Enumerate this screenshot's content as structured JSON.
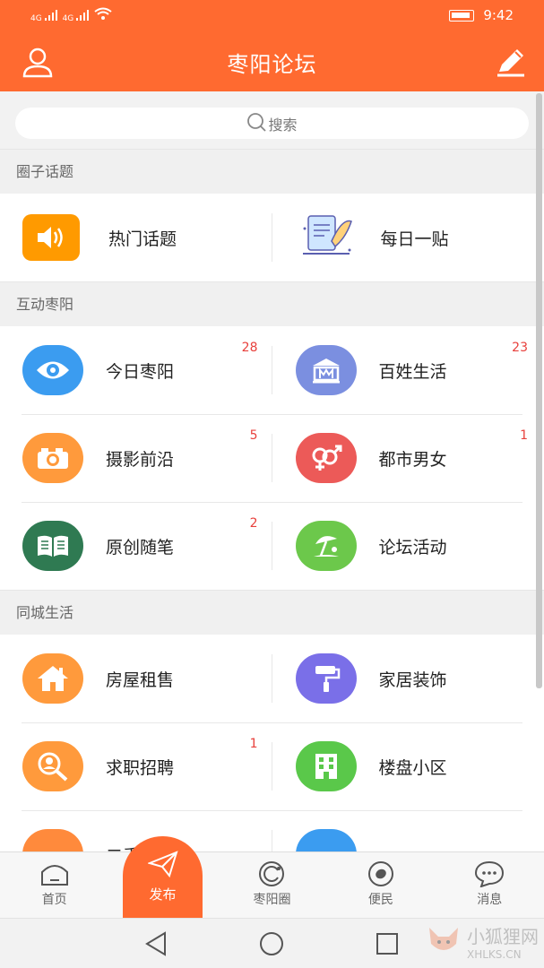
{
  "status_bar": {
    "signal_1": "4G",
    "signal_2": "4G",
    "time": "9:42"
  },
  "app_bar": {
    "title": "枣阳论坛",
    "left_icon": "user-icon",
    "right_icon": "edit-icon"
  },
  "search": {
    "placeholder": "搜索"
  },
  "sections": [
    {
      "title": "圈子话题",
      "rows": [
        [
          {
            "label": "热门话题",
            "icon": "speaker-icon",
            "color": "#ff9a00",
            "badge": ""
          },
          {
            "label": "每日一贴",
            "icon": "daily-post-icon",
            "color": "#ffffff",
            "badge": ""
          }
        ]
      ]
    },
    {
      "title": "互动枣阳",
      "rows": [
        [
          {
            "label": "今日枣阳",
            "icon": "eye-icon",
            "color": "#3b9cf0",
            "badge": "28"
          },
          {
            "label": "百姓生活",
            "icon": "building-icon",
            "color": "#7b8fe0",
            "badge": "23"
          }
        ],
        [
          {
            "label": "摄影前沿",
            "icon": "camera-icon",
            "color": "#ff9a3c",
            "badge": "5"
          },
          {
            "label": "都市男女",
            "icon": "gender-icon",
            "color": "#ec5a58",
            "badge": "1"
          }
        ],
        [
          {
            "label": "原创随笔",
            "icon": "book-icon",
            "color": "#2f7a52",
            "badge": "2"
          },
          {
            "label": "论坛活动",
            "icon": "beach-umbrella-icon",
            "color": "#6cc84b",
            "badge": ""
          }
        ]
      ]
    },
    {
      "title": "同城生活",
      "rows": [
        [
          {
            "label": "房屋租售",
            "icon": "house-icon",
            "color": "#ff9a3c",
            "badge": ""
          },
          {
            "label": "家居装饰",
            "icon": "paint-roller-icon",
            "color": "#7a6fe8",
            "badge": ""
          }
        ],
        [
          {
            "label": "求职招聘",
            "icon": "job-search-icon",
            "color": "#ff9a3c",
            "badge": "1"
          },
          {
            "label": "楼盘小区",
            "icon": "apartment-icon",
            "color": "#5ac84a",
            "badge": ""
          }
        ],
        [
          {
            "label": "二手...",
            "icon": "partial-icon",
            "color": "#ff8a3c",
            "badge": ""
          },
          {
            "label": "... ...",
            "icon": "partial-icon",
            "color": "#3b9cf0",
            "badge": ""
          }
        ]
      ]
    }
  ],
  "tabs": [
    {
      "label": "首页",
      "icon": "home-icon"
    },
    {
      "label": "发布",
      "icon": "send-icon"
    },
    {
      "label": "枣阳圈",
      "icon": "circle-icon"
    },
    {
      "label": "便民",
      "icon": "convenience-icon"
    },
    {
      "label": "消息",
      "icon": "message-icon"
    }
  ],
  "watermark": {
    "name": "小狐狸网",
    "domain": "XHLKS.CN"
  },
  "colors": {
    "brand": "#ff6a30",
    "badge": "#e8403c"
  }
}
